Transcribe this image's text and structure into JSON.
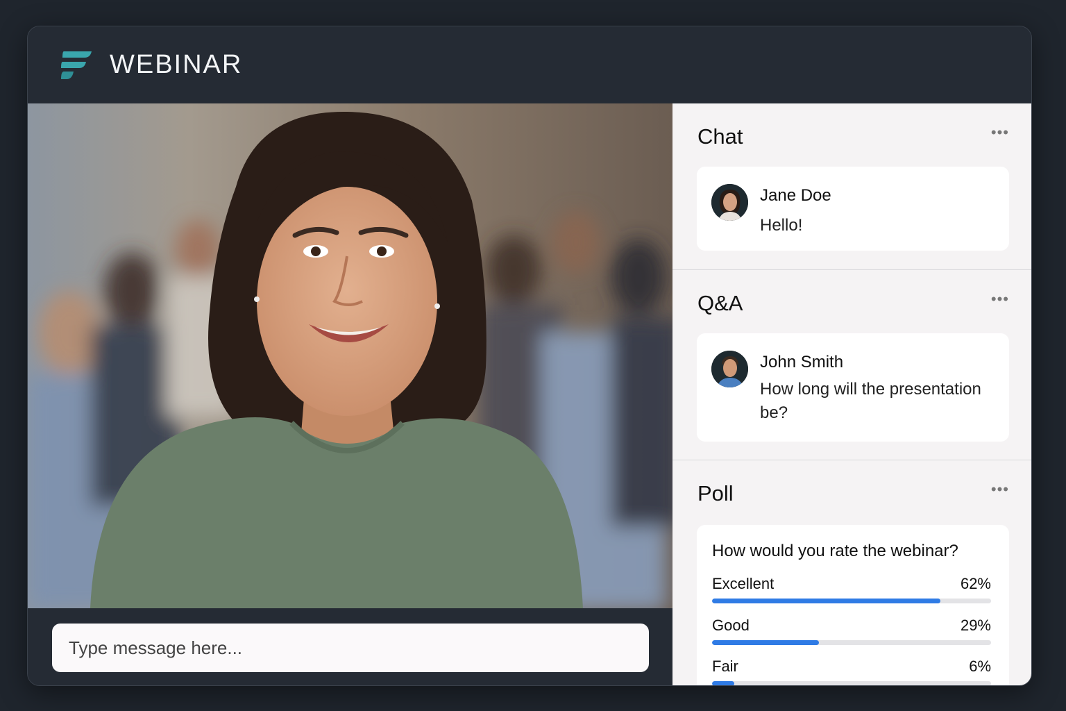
{
  "app": {
    "brand": "WEBINAR",
    "accent": "#3aa6ad"
  },
  "composer": {
    "placeholder": "Type message here..."
  },
  "chat": {
    "title": "Chat",
    "messages": [
      {
        "author": "Jane Doe",
        "text": "Hello!"
      }
    ]
  },
  "qa": {
    "title": "Q&A",
    "questions": [
      {
        "author": "John Smith",
        "text": "How long will the presentation be?"
      }
    ]
  },
  "poll": {
    "title": "Poll",
    "question": "How would you rate the webinar?",
    "bar_color": "#2f7be5",
    "options": [
      {
        "label": "Excellent",
        "percent_text": "62%",
        "percent": 62
      },
      {
        "label": "Good",
        "percent_text": "29%",
        "percent": 29
      },
      {
        "label": "Fair",
        "percent_text": "6%",
        "percent": 6
      }
    ]
  },
  "icons": {
    "menu": "more-dots-icon",
    "logo": "webinar-logo-icon"
  }
}
